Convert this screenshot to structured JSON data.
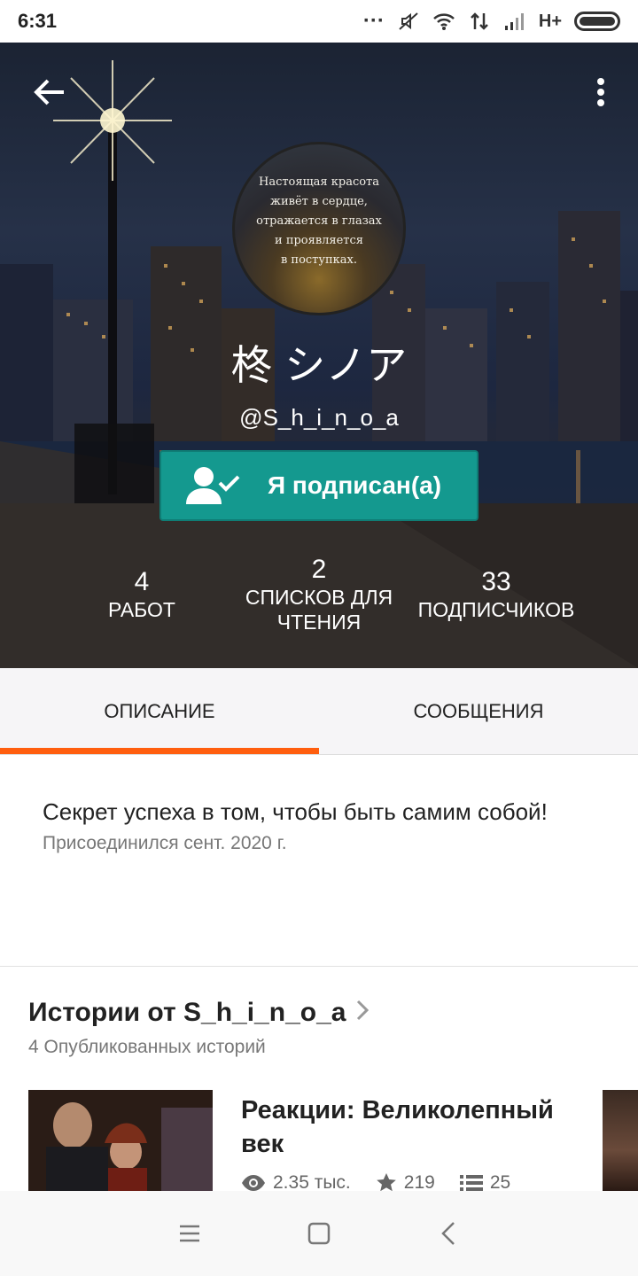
{
  "status_bar": {
    "time": "6:31",
    "network": "H+"
  },
  "profile": {
    "name": "柊 シノア",
    "handle": "@S_h_i_n_o_a",
    "avatar_quote": [
      "Настоящая красота",
      "живёт в сердце,",
      "отражается в глазах",
      "и проявляется",
      "в поступках."
    ],
    "follow_button": "Я подписан(а)",
    "stats": [
      {
        "value": "4",
        "label": "РАБОТ"
      },
      {
        "value": "2",
        "label": "СПИСКОВ ДЛЯ ЧТЕНИЯ"
      },
      {
        "value": "33",
        "label": "ПОДПИСЧИКОВ"
      }
    ]
  },
  "tabs": [
    {
      "label": "ОПИСАНИЕ",
      "active": true
    },
    {
      "label": "СООБЩЕНИЯ",
      "active": false
    }
  ],
  "description": {
    "bio": "Секрет успеха в том, чтобы быть самим собой!",
    "joined": "Присоединился сент. 2020 г."
  },
  "stories": {
    "title": "Истории от S_h_i_n_o_a",
    "count": "4 Опубликованных историй",
    "items": [
      {
        "title": "Реакции: Великолепный век",
        "views": "2.35 тыс.",
        "votes": "219",
        "parts": "25"
      }
    ]
  },
  "colors": {
    "accent": "#ff5e0e",
    "follow": "#14998f"
  },
  "icons": [
    "back-arrow-icon",
    "more-vert-icon",
    "user-check-icon",
    "eye-icon",
    "star-icon",
    "list-icon",
    "chevron-right-icon",
    "nav-menu-icon",
    "nav-home-icon",
    "nav-back-icon"
  ]
}
